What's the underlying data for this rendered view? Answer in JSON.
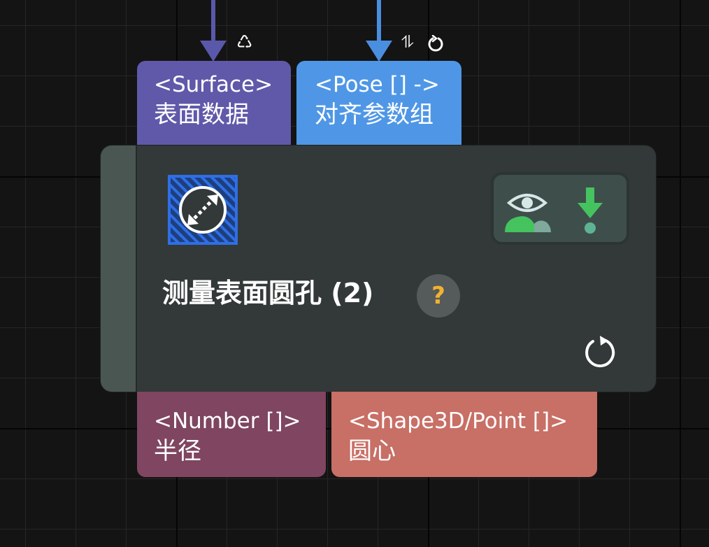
{
  "node": {
    "title": "测量表面圆孔 (2)",
    "help_label": "?",
    "inputs": [
      {
        "type": "<Surface>",
        "name": "表面数据"
      },
      {
        "type": "<Pose [] ->",
        "name": "对齐参数组"
      }
    ],
    "outputs": [
      {
        "type": "<Number []>",
        "name": "半径"
      },
      {
        "type": "<Shape3D/Point []>",
        "name": "圆心"
      }
    ]
  },
  "wires": {
    "surface_icon": "♺",
    "pose_icon": "⥮"
  },
  "icons": {
    "node_icon": "measure-diameter-icon",
    "visibility": "eye-icon",
    "output": "download-arrow-icon",
    "reset": "refresh-icon",
    "recycle": "recycle-icon",
    "transfer": "arrows-up-down-icon",
    "cycle": "cycle-icon"
  },
  "colors": {
    "surface_port": "#6059a9",
    "pose_port": "#4f97e6",
    "number_port": "#7f4561",
    "shape_port": "#c86f66",
    "node_body": "#323938",
    "accent_green": "#45c35f",
    "help_question": "#f2b230",
    "node_icon_blue": "#2f6ee6"
  }
}
